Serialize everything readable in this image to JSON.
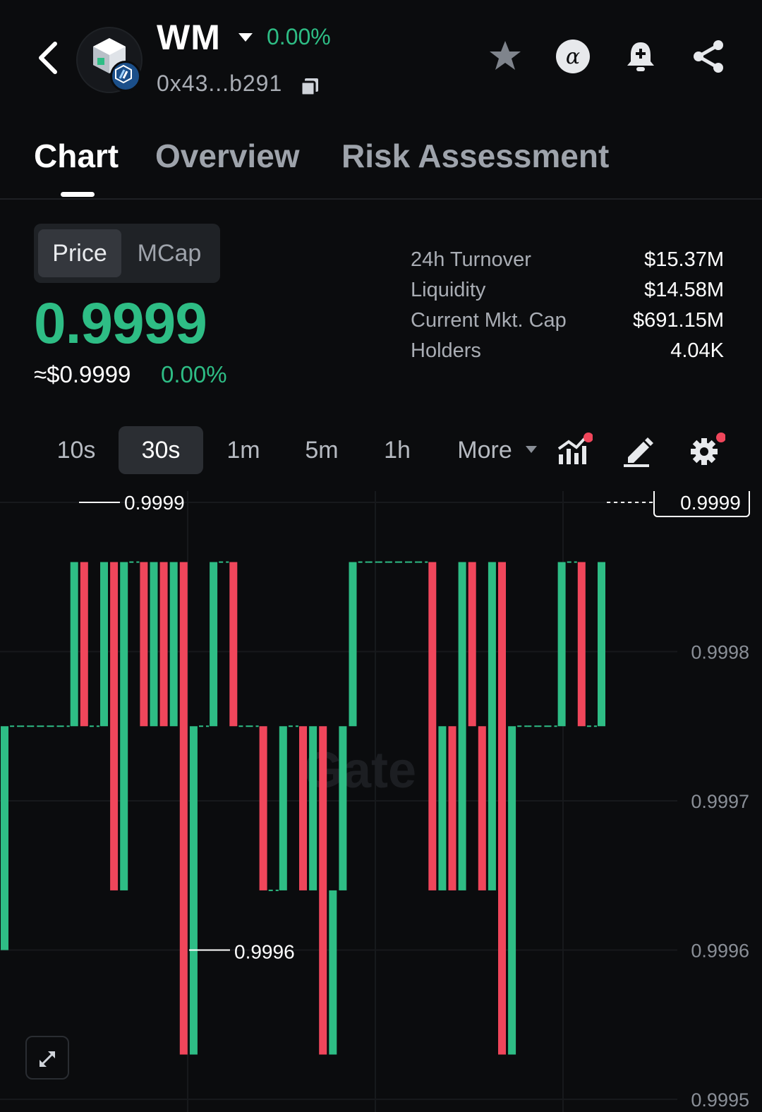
{
  "header": {
    "token_symbol": "WM",
    "change": "0.00%",
    "address": "0x43...b291",
    "icons": [
      "back-icon",
      "token-logo",
      "arbitrum-badge",
      "chevron-down-icon",
      "copy-icon",
      "star-icon",
      "alpha-icon",
      "bell-plus-icon",
      "share-icon"
    ]
  },
  "tabs": [
    {
      "label": "Chart",
      "active": true
    },
    {
      "label": "Overview",
      "active": false
    },
    {
      "label": "Risk Assessment",
      "active": false
    }
  ],
  "toggle": {
    "options": [
      "Price",
      "MCap"
    ],
    "selected": "Price"
  },
  "price": {
    "value": "0.9999",
    "usd": "≈$0.9999",
    "change": "0.00%"
  },
  "stats": [
    {
      "label": "24h Turnover",
      "value": "$15.37M"
    },
    {
      "label": "Liquidity",
      "value": "$14.58M"
    },
    {
      "label": "Current Mkt. Cap",
      "value": "$691.15M"
    },
    {
      "label": "Holders",
      "value": "4.04K"
    }
  ],
  "timeframes": {
    "options": [
      "10s",
      "30s",
      "1m",
      "5m",
      "1h",
      "More"
    ],
    "selected": "30s",
    "tool_icons": [
      "indicators-icon",
      "draw-icon",
      "settings-icon",
      "expand-icon"
    ]
  },
  "colors": {
    "up": "#2ebd85",
    "down": "#f0465b",
    "background": "#0b0c0e",
    "accent_dot": "#f0465b"
  },
  "chart_data": {
    "type": "candlestick",
    "interval": "30s",
    "watermark": "Gate",
    "ylim": [
      0.9995,
      0.9999
    ],
    "y_ticks": [
      "0.9999",
      "0.9998",
      "0.9997",
      "0.9996",
      "0.9995"
    ],
    "last_price_label": "0.9999",
    "high_label": "0.9999",
    "low_label": "0.9996",
    "candles": [
      {
        "o": 0.99975,
        "c": 0.9996,
        "dir": "up"
      },
      {
        "o": 0.99975,
        "c": 0.99975,
        "dir": "flat"
      },
      {
        "o": 0.99975,
        "c": 0.99975,
        "dir": "flat"
      },
      {
        "o": 0.99975,
        "c": 0.99975,
        "dir": "flat"
      },
      {
        "o": 0.99975,
        "c": 0.99975,
        "dir": "flat"
      },
      {
        "o": 0.99975,
        "c": 0.99975,
        "dir": "flat"
      },
      {
        "o": 0.99975,
        "c": 0.99975,
        "dir": "flat"
      },
      {
        "o": 0.99975,
        "c": 0.99986,
        "dir": "up"
      },
      {
        "o": 0.99986,
        "c": 0.99975,
        "dir": "down"
      },
      {
        "o": 0.99975,
        "c": 0.99975,
        "dir": "flat"
      },
      {
        "o": 0.99975,
        "c": 0.99986,
        "dir": "up"
      },
      {
        "o": 0.99986,
        "c": 0.99964,
        "dir": "down"
      },
      {
        "o": 0.99964,
        "c": 0.99986,
        "dir": "up"
      },
      {
        "o": 0.99986,
        "c": 0.99986,
        "dir": "flat"
      },
      {
        "o": 0.99986,
        "c": 0.99975,
        "dir": "down"
      },
      {
        "o": 0.99975,
        "c": 0.99986,
        "dir": "up"
      },
      {
        "o": 0.99986,
        "c": 0.99975,
        "dir": "down"
      },
      {
        "o": 0.99975,
        "c": 0.99986,
        "dir": "up"
      },
      {
        "o": 0.99986,
        "c": 0.99953,
        "dir": "down"
      },
      {
        "o": 0.99953,
        "c": 0.99975,
        "dir": "up"
      },
      {
        "o": 0.99975,
        "c": 0.99975,
        "dir": "flat"
      },
      {
        "o": 0.99975,
        "c": 0.99986,
        "dir": "up"
      },
      {
        "o": 0.99986,
        "c": 0.99986,
        "dir": "flat"
      },
      {
        "o": 0.99986,
        "c": 0.99975,
        "dir": "down"
      },
      {
        "o": 0.99975,
        "c": 0.99975,
        "dir": "flat"
      },
      {
        "o": 0.99975,
        "c": 0.99975,
        "dir": "flat"
      },
      {
        "o": 0.99975,
        "c": 0.99964,
        "dir": "down"
      },
      {
        "o": 0.99964,
        "c": 0.99964,
        "dir": "flat"
      },
      {
        "o": 0.99964,
        "c": 0.99975,
        "dir": "up"
      },
      {
        "o": 0.99975,
        "c": 0.99975,
        "dir": "flat"
      },
      {
        "o": 0.99975,
        "c": 0.99964,
        "dir": "down"
      },
      {
        "o": 0.99964,
        "c": 0.99975,
        "dir": "up"
      },
      {
        "o": 0.99975,
        "c": 0.99953,
        "dir": "down"
      },
      {
        "o": 0.99953,
        "c": 0.99964,
        "dir": "up"
      },
      {
        "o": 0.99964,
        "c": 0.99975,
        "dir": "up"
      },
      {
        "o": 0.99975,
        "c": 0.99986,
        "dir": "up"
      },
      {
        "o": 0.99986,
        "c": 0.99986,
        "dir": "flat"
      },
      {
        "o": 0.99986,
        "c": 0.99986,
        "dir": "flat"
      },
      {
        "o": 0.99986,
        "c": 0.99986,
        "dir": "flat"
      },
      {
        "o": 0.99986,
        "c": 0.99986,
        "dir": "flat"
      },
      {
        "o": 0.99986,
        "c": 0.99986,
        "dir": "flat"
      },
      {
        "o": 0.99986,
        "c": 0.99986,
        "dir": "flat"
      },
      {
        "o": 0.99986,
        "c": 0.99986,
        "dir": "flat"
      },
      {
        "o": 0.99986,
        "c": 0.99964,
        "dir": "down"
      },
      {
        "o": 0.99964,
        "c": 0.99975,
        "dir": "up"
      },
      {
        "o": 0.99975,
        "c": 0.99964,
        "dir": "down"
      },
      {
        "o": 0.99964,
        "c": 0.99986,
        "dir": "up"
      },
      {
        "o": 0.99986,
        "c": 0.99975,
        "dir": "down"
      },
      {
        "o": 0.99975,
        "c": 0.99964,
        "dir": "down"
      },
      {
        "o": 0.99964,
        "c": 0.99986,
        "dir": "up"
      },
      {
        "o": 0.99986,
        "c": 0.99953,
        "dir": "down"
      },
      {
        "o": 0.99953,
        "c": 0.99975,
        "dir": "up"
      },
      {
        "o": 0.99975,
        "c": 0.99975,
        "dir": "flat"
      },
      {
        "o": 0.99975,
        "c": 0.99975,
        "dir": "flat"
      },
      {
        "o": 0.99975,
        "c": 0.99975,
        "dir": "flat"
      },
      {
        "o": 0.99975,
        "c": 0.99975,
        "dir": "flat"
      },
      {
        "o": 0.99975,
        "c": 0.99986,
        "dir": "up"
      },
      {
        "o": 0.99986,
        "c": 0.99986,
        "dir": "flat"
      },
      {
        "o": 0.99986,
        "c": 0.99975,
        "dir": "down"
      },
      {
        "o": 0.99975,
        "c": 0.99975,
        "dir": "flat"
      },
      {
        "o": 0.99975,
        "c": 0.99986,
        "dir": "up"
      }
    ]
  }
}
